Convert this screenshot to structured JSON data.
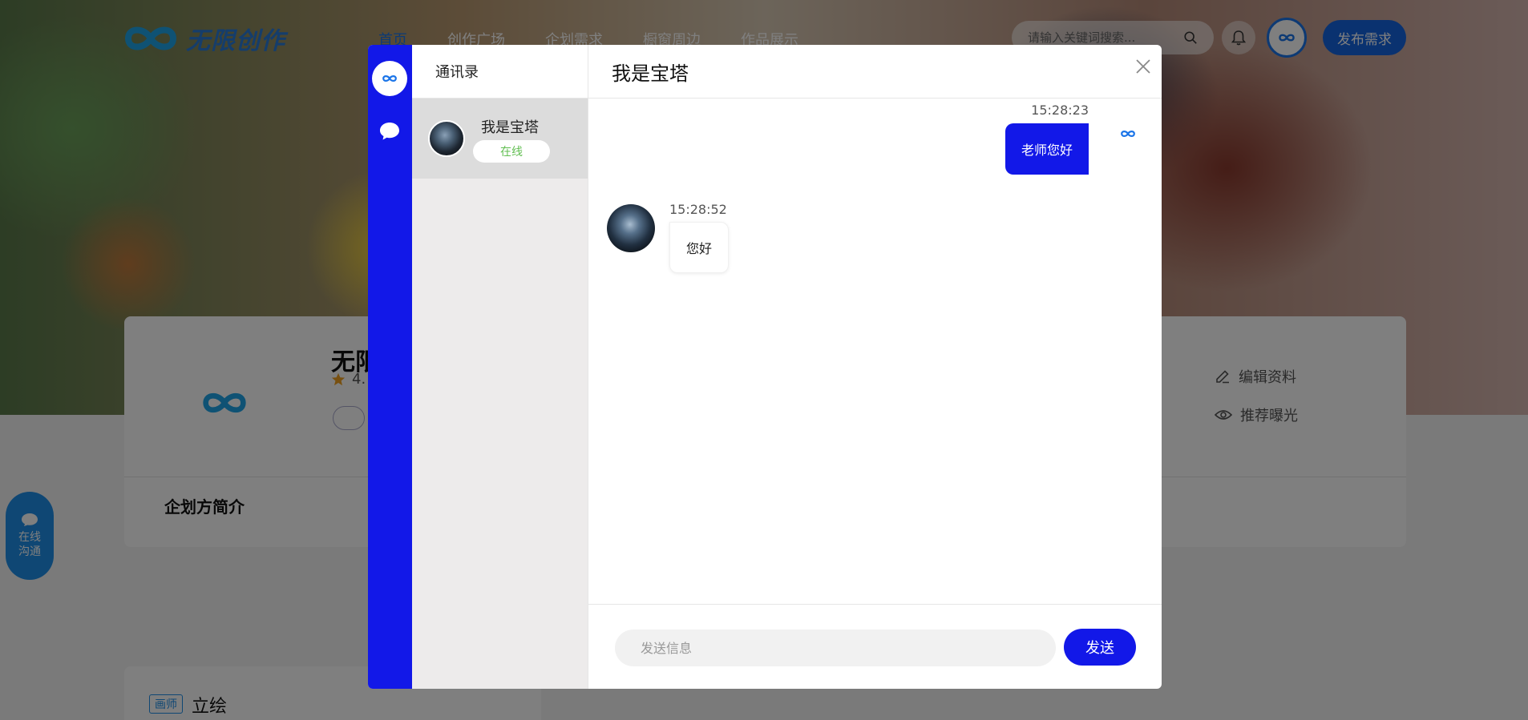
{
  "brand": {
    "text": "无限创作",
    "logo_icon": "infinity-logo-icon"
  },
  "nav": {
    "items": [
      {
        "label": "首页",
        "active": true
      },
      {
        "label": "创作广场"
      },
      {
        "label": "企划需求"
      },
      {
        "label": "橱窗周边"
      },
      {
        "label": "作品展示"
      }
    ]
  },
  "search": {
    "placeholder": "请输入关键词搜索..."
  },
  "header": {
    "publish_label": "发布需求"
  },
  "profile": {
    "name": "无限",
    "rating": "4.",
    "intro_heading": "企划方简介",
    "actions": [
      {
        "label": "编辑资料",
        "icon": "edit-icon"
      },
      {
        "label": "推荐曝光",
        "icon": "eye-icon"
      }
    ]
  },
  "side_float": {
    "line1": "在线",
    "line2": "沟通"
  },
  "card2": {
    "tag": "画师",
    "title": "立绘"
  },
  "chat": {
    "contacts_title": "通讯录",
    "contacts": [
      {
        "name": "我是宝塔",
        "status": "在线"
      }
    ],
    "conversation_title": "我是宝塔",
    "messages": [
      {
        "direction": "out",
        "time": "15:28:23",
        "text": "老师您好"
      },
      {
        "direction": "in",
        "time": "15:28:52",
        "text": "您好"
      }
    ],
    "input_placeholder": "发送信息",
    "send_label": "发送"
  },
  "colors": {
    "accent": "#1218e8",
    "brand_blue": "#1565e0",
    "online": "#62bf52"
  }
}
